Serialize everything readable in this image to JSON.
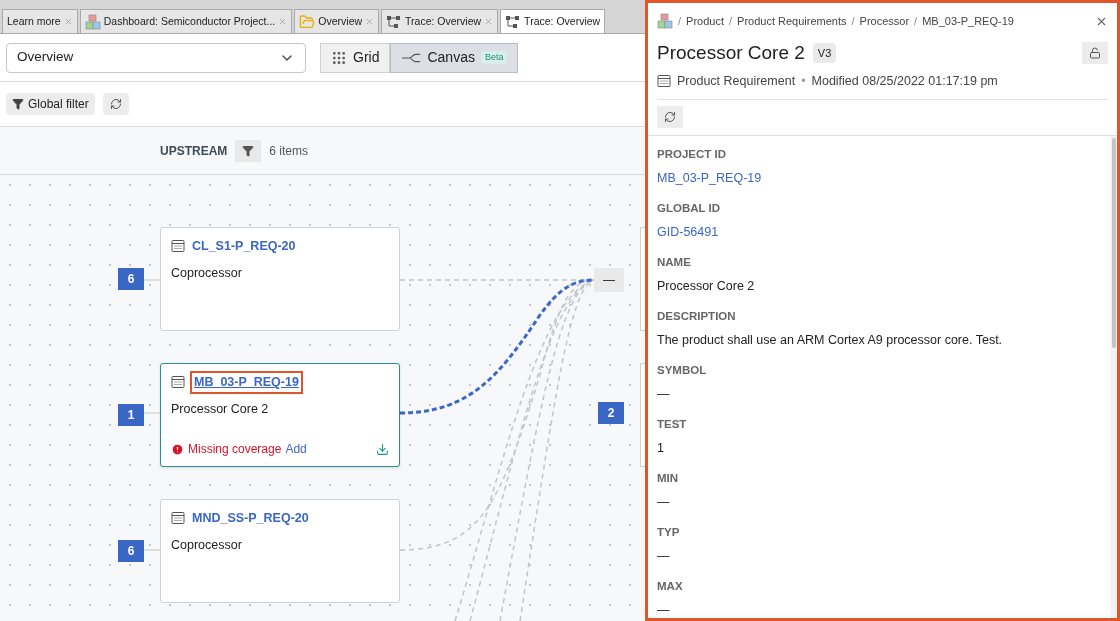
{
  "tabs": [
    {
      "label": "Learn more",
      "selected": false
    },
    {
      "label": "Dashboard: Semiconductor Project...",
      "selected": false
    },
    {
      "label": "Overview",
      "selected": false
    },
    {
      "label": "Trace: Overview",
      "selected": false
    },
    {
      "label": "Trace: Overview",
      "selected": true
    }
  ],
  "view_select": {
    "value": "Overview"
  },
  "view_modes": [
    {
      "label": "Grid",
      "selected": false
    },
    {
      "label": "Canvas",
      "badge": "Beta",
      "selected": true
    }
  ],
  "filter_button": "Global filter",
  "column": {
    "title": "UPSTREAM",
    "count": "6 items"
  },
  "cards": [
    {
      "id": "CL_S1-P_REQ-20",
      "name": "Coprocessor",
      "count": "6",
      "selected": false
    },
    {
      "id": "MB_03-P_REQ-19",
      "name": "Processor Core 2",
      "count": "1",
      "selected": true,
      "warning": "Missing coverage",
      "action": "Add"
    },
    {
      "id": "MND_SS-P_REQ-20",
      "name": "Coprocessor",
      "count": "6",
      "selected": false
    }
  ],
  "right_node": {
    "count": "2",
    "collapse": "—"
  },
  "panel": {
    "breadcrumb": [
      "Product",
      "Product Requirements",
      "Processor",
      "MB_03-P_REQ-19"
    ],
    "breadcrumb_separator": "/",
    "meta_separator": "•",
    "title": "Processor Core 2",
    "version": "V3",
    "type": "Product Requirement",
    "modified": "Modified 08/25/2022 01:17:19 pm",
    "fields": [
      {
        "label": "PROJECT ID",
        "value": "MB_03-P_REQ-19",
        "kind": "link"
      },
      {
        "label": "GLOBAL ID",
        "value": "GID-56491",
        "kind": "link"
      },
      {
        "label": "NAME",
        "value": "Processor Core 2",
        "kind": "text"
      },
      {
        "label": "DESCRIPTION",
        "value": "The product shall use an ARM Cortex A9 processor core. Test.",
        "kind": "text"
      },
      {
        "label": "SYMBOL",
        "value": "—",
        "kind": "text"
      },
      {
        "label": "TEST",
        "value": "1",
        "kind": "text"
      },
      {
        "label": "MIN",
        "value": "—",
        "kind": "text"
      },
      {
        "label": "TYP",
        "value": "—",
        "kind": "text"
      },
      {
        "label": "MAX",
        "value": "—",
        "kind": "text"
      }
    ]
  }
}
